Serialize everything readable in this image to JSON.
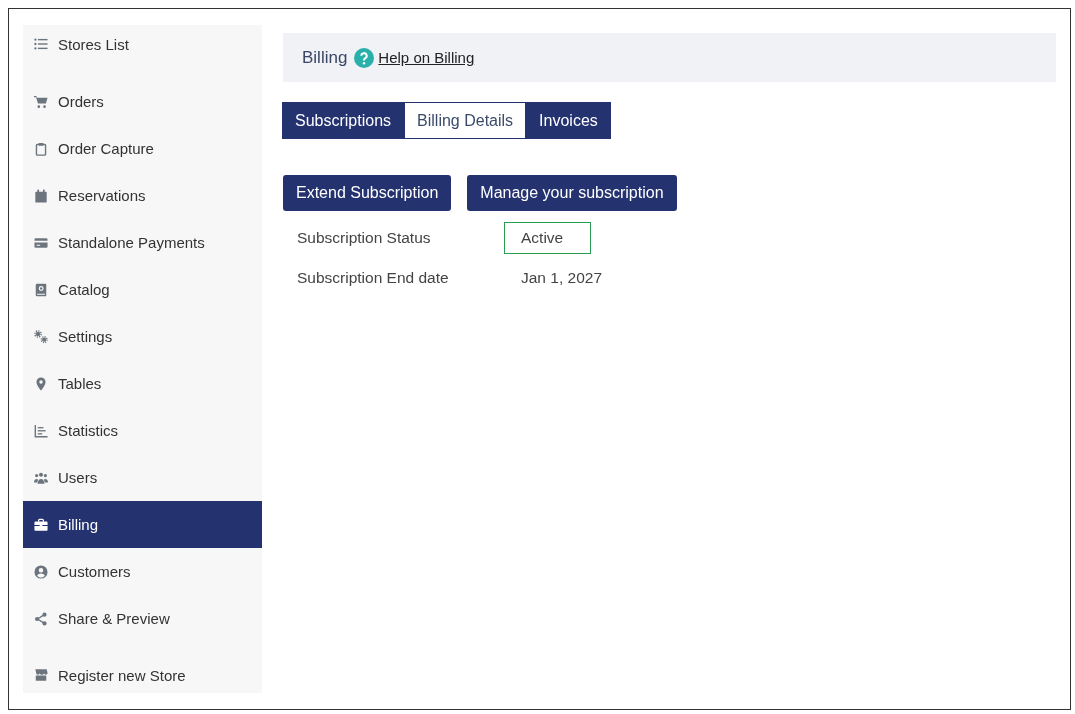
{
  "sidebar": {
    "header": {
      "label": "Stores List"
    },
    "items": [
      {
        "label": "Orders",
        "selected": false
      },
      {
        "label": "Order Capture",
        "selected": false
      },
      {
        "label": "Reservations",
        "selected": false
      },
      {
        "label": "Standalone Payments",
        "selected": false
      },
      {
        "label": "Catalog",
        "selected": false
      },
      {
        "label": "Settings",
        "selected": false
      },
      {
        "label": "Tables",
        "selected": false
      },
      {
        "label": "Statistics",
        "selected": false
      },
      {
        "label": "Users",
        "selected": false
      },
      {
        "label": "Billing",
        "selected": true
      },
      {
        "label": "Customers",
        "selected": false
      },
      {
        "label": "Share & Preview",
        "selected": false
      }
    ],
    "footer": {
      "label": "Register new Store"
    }
  },
  "header": {
    "title": "Billing",
    "help_link": "Help on Billing"
  },
  "tabs": [
    {
      "label": "Subscriptions",
      "selected": false
    },
    {
      "label": "Billing Details",
      "selected": true
    },
    {
      "label": "Invoices",
      "selected": false
    }
  ],
  "actions": [
    "Extend Subscription",
    "Manage your subscription"
  ],
  "details": [
    {
      "label": "Subscription Status",
      "value": "Active",
      "kind": "badge"
    },
    {
      "label": "Subscription End date",
      "value": "Jan 1, 2027",
      "kind": "text"
    }
  ]
}
